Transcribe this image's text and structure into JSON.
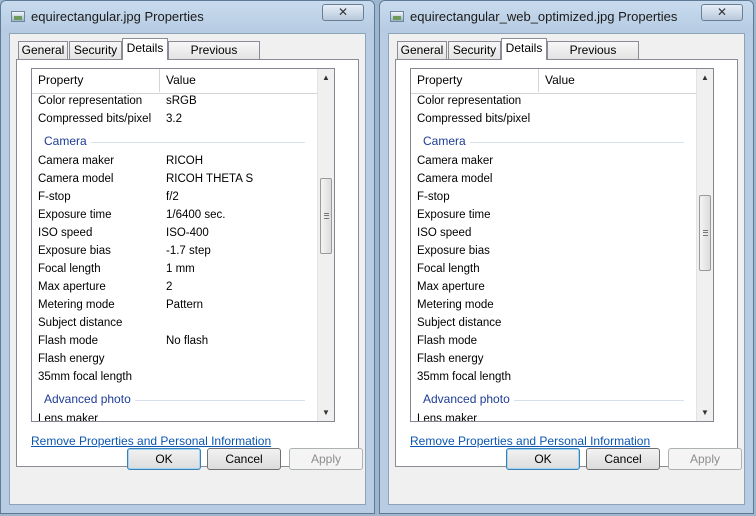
{
  "windows": [
    {
      "title": "equirectangular.jpg Properties",
      "close_label": "✕",
      "tabs": [
        "General",
        "Security",
        "Details",
        "Previous Versions"
      ],
      "active_tab": "Details",
      "columns": {
        "property": "Property",
        "value": "Value"
      },
      "rows_top": [
        {
          "p": "Color representation",
          "v": "sRGB"
        },
        {
          "p": "Compressed bits/pixel",
          "v": "3.2"
        }
      ],
      "group_camera": "Camera",
      "rows_camera": [
        {
          "p": "Camera maker",
          "v": "RICOH"
        },
        {
          "p": "Camera model",
          "v": "RICOH THETA S"
        },
        {
          "p": "F-stop",
          "v": "f/2"
        },
        {
          "p": "Exposure time",
          "v": "1/6400 sec."
        },
        {
          "p": "ISO speed",
          "v": "ISO-400"
        },
        {
          "p": "Exposure bias",
          "v": "-1.7 step"
        },
        {
          "p": "Focal length",
          "v": "1 mm"
        },
        {
          "p": "Max aperture",
          "v": "2"
        },
        {
          "p": "Metering mode",
          "v": "Pattern"
        },
        {
          "p": "Subject distance",
          "v": ""
        },
        {
          "p": "Flash mode",
          "v": "No flash"
        },
        {
          "p": "Flash energy",
          "v": ""
        },
        {
          "p": "35mm focal length",
          "v": ""
        }
      ],
      "group_advanced": "Advanced photo",
      "partial_row": "Lens maker",
      "remove_link": "Remove Properties and Personal Information",
      "buttons": {
        "ok": "OK",
        "cancel": "Cancel",
        "apply": "Apply"
      }
    },
    {
      "title": "equirectangular_web_optimized.jpg Properties",
      "close_label": "✕",
      "tabs": [
        "General",
        "Security",
        "Details",
        "Previous Versions"
      ],
      "active_tab": "Details",
      "columns": {
        "property": "Property",
        "value": "Value"
      },
      "rows_top": [
        {
          "p": "Color representation",
          "v": ""
        },
        {
          "p": "Compressed bits/pixel",
          "v": ""
        }
      ],
      "group_camera": "Camera",
      "rows_camera": [
        {
          "p": "Camera maker",
          "v": ""
        },
        {
          "p": "Camera model",
          "v": ""
        },
        {
          "p": "F-stop",
          "v": ""
        },
        {
          "p": "Exposure time",
          "v": ""
        },
        {
          "p": "ISO speed",
          "v": ""
        },
        {
          "p": "Exposure bias",
          "v": ""
        },
        {
          "p": "Focal length",
          "v": ""
        },
        {
          "p": "Max aperture",
          "v": ""
        },
        {
          "p": "Metering mode",
          "v": ""
        },
        {
          "p": "Subject distance",
          "v": ""
        },
        {
          "p": "Flash mode",
          "v": ""
        },
        {
          "p": "Flash energy",
          "v": ""
        },
        {
          "p": "35mm focal length",
          "v": ""
        }
      ],
      "group_advanced": "Advanced photo",
      "partial_row": "Lens maker",
      "remove_link": "Remove Properties and Personal Information",
      "buttons": {
        "ok": "OK",
        "cancel": "Cancel",
        "apply": "Apply"
      }
    }
  ],
  "scroll": {
    "left_position": 0.38,
    "right_position": 0.45
  }
}
